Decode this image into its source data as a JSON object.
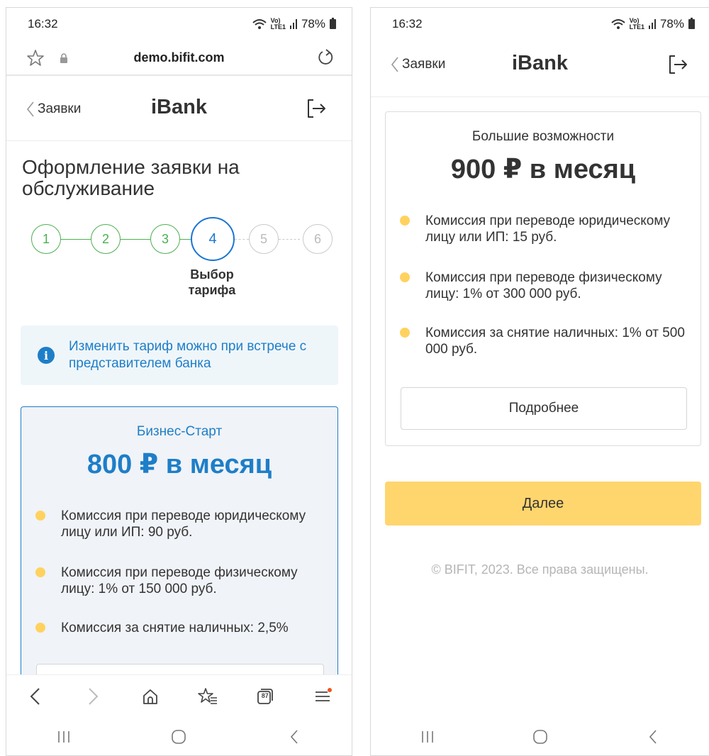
{
  "status": {
    "time": "16:32",
    "battery": "78%",
    "network": "LTE1"
  },
  "browser": {
    "url": "demo.bifit.com",
    "tab_count": "87"
  },
  "header": {
    "back_label": "Заявки",
    "title": "iBank"
  },
  "page": {
    "heading": "Оформление заявки на обслуживание"
  },
  "stepper": {
    "steps": [
      "1",
      "2",
      "3",
      "4",
      "5",
      "6"
    ],
    "current_index": 3,
    "current_caption": "Выбор тарифа"
  },
  "info": {
    "text": "Изменить тариф можно при встрече с представителем банка"
  },
  "tariffs": [
    {
      "name": "Бизнес-Старт",
      "price": "800 ₽ в месяц",
      "features": [
        "Комиссия при переводе юридическому лицу или ИП: 90 руб.",
        "Комиссия при переводе физическому лицу: 1% от 150 000 руб.",
        "Комиссия за снятие наличных: 2,5%"
      ]
    },
    {
      "name": "Большие возможности",
      "price": "900 ₽ в месяц",
      "features": [
        "Комиссия при переводе юридическому лицу или ИП: 15 руб.",
        "Комиссия при переводе физическому лицу: 1% от 300 000 руб.",
        "Комиссия за снятие наличных: 1% от 500 000 руб."
      ],
      "more_label": "Подробнее"
    }
  ],
  "actions": {
    "next_label": "Далее"
  },
  "footer": {
    "copyright": "© BIFIT, 2023. Все права защищены."
  },
  "colors": {
    "accent": "#1e7ec8",
    "success": "#4caf50",
    "bullet": "#ffd260",
    "primary_button": "#ffd56e"
  }
}
